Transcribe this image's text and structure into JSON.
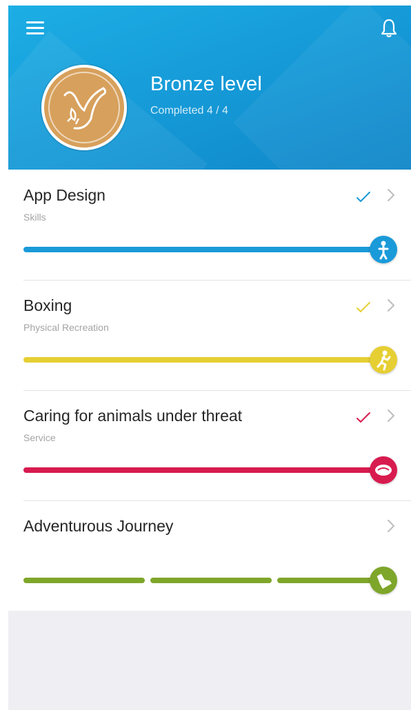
{
  "header": {
    "level_title": "Bronze level",
    "completed_text": "Completed 4 / 4",
    "bg_color": "#1598d6",
    "badge_color": "#d7a05c",
    "menu_icon": "hamburger-menu-icon",
    "notification_icon": "bell-icon"
  },
  "activities": [
    {
      "title": "App Design",
      "subtitle": "Skills",
      "color": "#1a9ad9",
      "checked": true,
      "progress": 1.0,
      "icon": "skills-person-icon"
    },
    {
      "title": "Boxing",
      "subtitle": "Physical Recreation",
      "color": "#e6cf33",
      "checked": true,
      "progress": 1.0,
      "icon": "running-person-icon"
    },
    {
      "title": "Caring for animals under threat",
      "subtitle": "Service",
      "color": "#d81b4f",
      "checked": true,
      "progress": 1.0,
      "icon": "heart-hands-icon"
    },
    {
      "title": "Adventurous Journey",
      "subtitle": "",
      "color": "#7ea62a",
      "checked": false,
      "progress": 1.0,
      "segments": 3,
      "icon": "boot-icon"
    }
  ]
}
